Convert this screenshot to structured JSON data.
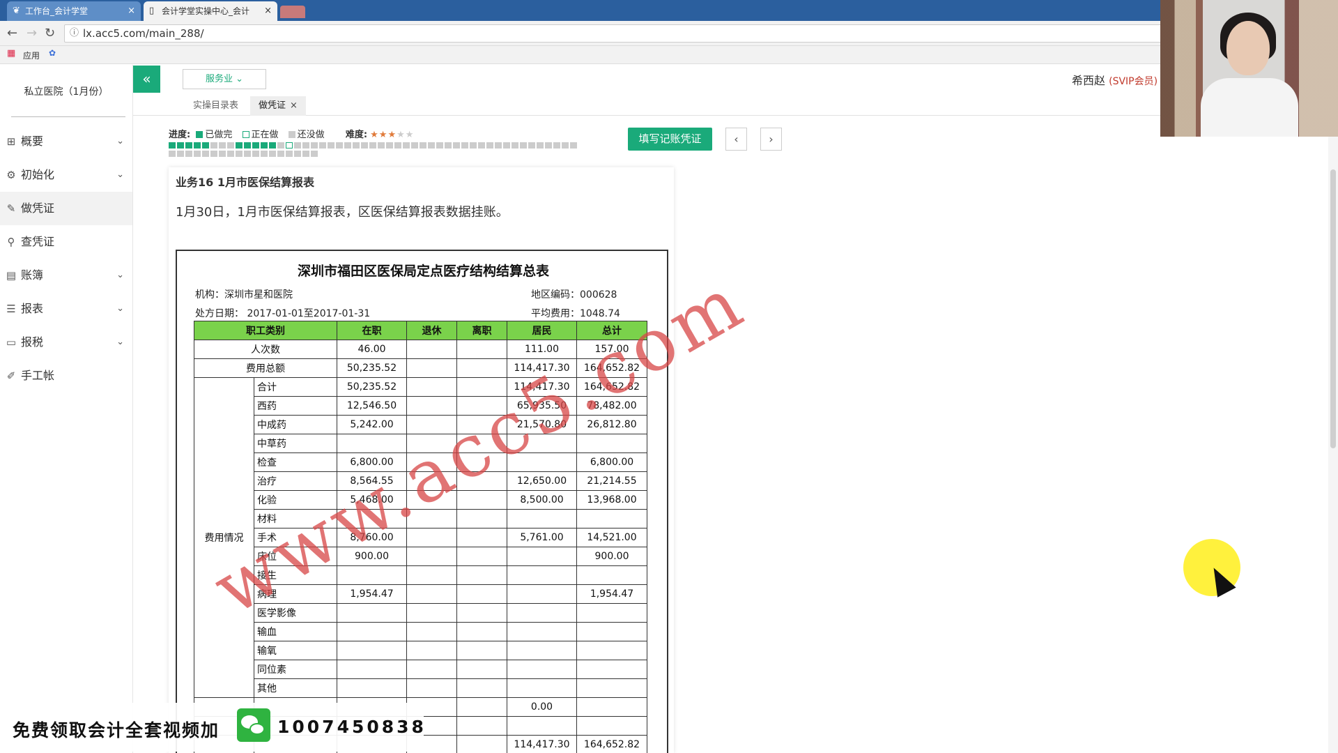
{
  "browser": {
    "tabs": [
      {
        "label": "工作台_会计学堂",
        "icon": "leaf-icon"
      },
      {
        "label": "会计学堂实操中心_会计",
        "icon": "page-icon"
      }
    ],
    "url": "lx.acc5.com/main_288/",
    "bookmarks_label": "应用"
  },
  "sidebar": {
    "company": "私立医院（1月份）",
    "items": [
      {
        "label": "概要",
        "icon": "grid-icon",
        "chevron": true
      },
      {
        "label": "初始化",
        "icon": "gear-icon",
        "chevron": true
      },
      {
        "label": "做凭证",
        "icon": "pencil-icon",
        "chevron": false,
        "active": true
      },
      {
        "label": "查凭证",
        "icon": "search-icon",
        "chevron": false
      },
      {
        "label": "账簿",
        "icon": "book-icon",
        "chevron": true
      },
      {
        "label": "报表",
        "icon": "list-icon",
        "chevron": true
      },
      {
        "label": "报税",
        "icon": "file-icon",
        "chevron": true
      },
      {
        "label": "手工帐",
        "icon": "pen-icon",
        "chevron": false
      }
    ]
  },
  "header": {
    "collapse_icon": "«",
    "industry": "服务业",
    "user_name": "希西赵",
    "user_level": "(SVIP会员)",
    "subtabs": [
      {
        "label": "实操目录表"
      },
      {
        "label": "做凭证",
        "closable": true
      }
    ]
  },
  "progress": {
    "label": "进度:",
    "done": "已做完",
    "doing": "正在做",
    "todo": "还没做",
    "difficulty_label": "难度:",
    "difficulty": 3,
    "difficulty_max": 5,
    "fill_button": "填写记账凭证",
    "prev": "‹",
    "next": "›",
    "cells_row1": "dddddtttdddddtitttttttttttttttttttttttttttttttttt",
    "cells_row2": "tttttttttttttttttt",
    "colors": {
      "done": "#1aaa7a",
      "todo": "#cccccc"
    }
  },
  "task": {
    "title": "业务16 1月市医保结算报表",
    "description": "1月30日，1月市医保结算报表，区医保结算报表数据挂账。"
  },
  "statement": {
    "title": "深圳市福田区医保局定点医疗结构结算总表",
    "org": "机构：深圳市星和医院",
    "region_code": "地区编码：000628",
    "date": "处方日期：   2017-01-01至2017-01-31",
    "avg_fee": "平均费用：1048.74",
    "headers": [
      "职工类别",
      "在职",
      "退休",
      "离职",
      "居民",
      "总计"
    ],
    "rows_top": [
      {
        "label": "人次数",
        "zaizhi": "46.00",
        "tuixiu": "",
        "lizhi": "",
        "jumin": "111.00",
        "total": "157.00"
      },
      {
        "label": "费用总额",
        "zaizhi": "50,235.52",
        "tuixiu": "",
        "lizhi": "",
        "jumin": "114,417.30",
        "total": "164,652.82"
      }
    ],
    "group_label": "费用情况",
    "group_rows": [
      {
        "label": "合计",
        "zaizhi": "50,235.52",
        "jumin": "114,417.30",
        "total": "164,652.82"
      },
      {
        "label": "西药",
        "zaizhi": "12,546.50",
        "jumin": "65,935.50",
        "total": "78,482.00"
      },
      {
        "label": "中成药",
        "zaizhi": "5,242.00",
        "jumin": "21,570.80",
        "total": "26,812.80"
      },
      {
        "label": "中草药",
        "zaizhi": "",
        "jumin": "",
        "total": ""
      },
      {
        "label": "检查",
        "zaizhi": "6,800.00",
        "jumin": "",
        "total": "6,800.00"
      },
      {
        "label": "治疗",
        "zaizhi": "8,564.55",
        "jumin": "12,650.00",
        "total": "21,214.55"
      },
      {
        "label": "化验",
        "zaizhi": "5,468.00",
        "jumin": "8,500.00",
        "total": "13,968.00"
      },
      {
        "label": "材料",
        "zaizhi": "",
        "jumin": "",
        "total": ""
      },
      {
        "label": "手术",
        "zaizhi": "8,760.00",
        "jumin": "5,761.00",
        "total": "14,521.00"
      },
      {
        "label": "床位",
        "zaizhi": "900.00",
        "jumin": "",
        "total": "900.00"
      },
      {
        "label": "接生",
        "zaizhi": "",
        "jumin": "",
        "total": ""
      },
      {
        "label": "病理",
        "zaizhi": "1,954.47",
        "jumin": "",
        "total": "1,954.47"
      },
      {
        "label": "医学影像",
        "zaizhi": "",
        "jumin": "",
        "total": ""
      },
      {
        "label": "输血",
        "zaizhi": "",
        "jumin": "",
        "total": ""
      },
      {
        "label": "输氧",
        "zaizhi": "",
        "jumin": "",
        "total": ""
      },
      {
        "label": "同位素",
        "zaizhi": "",
        "jumin": "",
        "total": ""
      },
      {
        "label": "其他",
        "zaizhi": "",
        "jumin": "",
        "total": ""
      },
      {
        "label": "",
        "zaizhi": "",
        "jumin": "0.00",
        "total": ""
      },
      {
        "label": "",
        "zaizhi": "",
        "jumin": "",
        "total": ""
      },
      {
        "label": "",
        "zaizhi": "",
        "jumin": "114,417.30",
        "total": "164,652.82"
      }
    ]
  },
  "overlays": {
    "watermark": "www.acc5.com",
    "promo_text": "免费领取会计全套视频加",
    "promo_number": "1007450838"
  }
}
